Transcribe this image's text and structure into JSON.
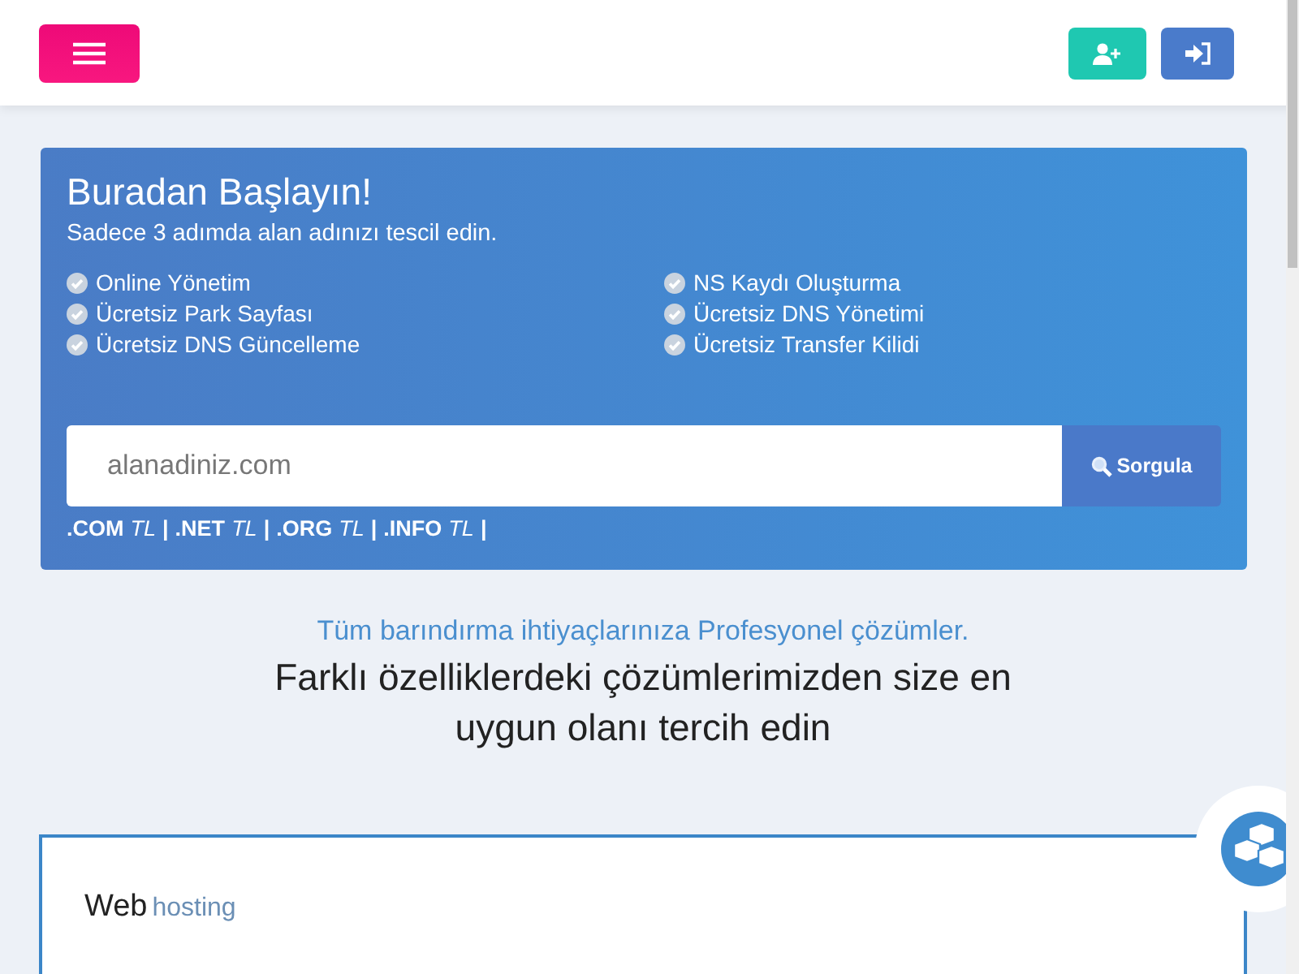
{
  "header": {
    "buttons": [
      {
        "kind": "register"
      },
      {
        "kind": "login"
      }
    ]
  },
  "hero": {
    "title": "Buradan Başlayın!",
    "subtitle": "Sadece 3 adımda alan adınızı tescil edin.",
    "features": [
      [
        "Online Yönetim",
        "Ücretsiz Park Sayfası",
        "Ücretsiz DNS Güncelleme"
      ],
      [
        "NS Kaydı Oluşturma",
        "Ücretsiz DNS Yönetimi",
        "Ücretsiz Transfer Kilidi"
      ]
    ],
    "search": {
      "placeholder": "alanadiniz.com",
      "button": "Sorgula"
    },
    "tlds": [
      {
        "ext": ".COM",
        "currency": "TL",
        "separator": "|"
      },
      {
        "ext": ".NET",
        "currency": "TL",
        "separator": "|"
      },
      {
        "ext": ".ORG",
        "currency": "TL",
        "separator": "|"
      },
      {
        "ext": ".INFO",
        "currency": "TL",
        "separator": "|"
      }
    ]
  },
  "intro": {
    "tagline": "Tüm barındırma ihtiyaçlarınıza Profesyonel çözümler.",
    "heading": "Farklı özelliklerdeki çözümlerimizden size en uygun olanı tercih edin"
  },
  "card": {
    "title": "Web",
    "title_suffix": "hosting"
  }
}
